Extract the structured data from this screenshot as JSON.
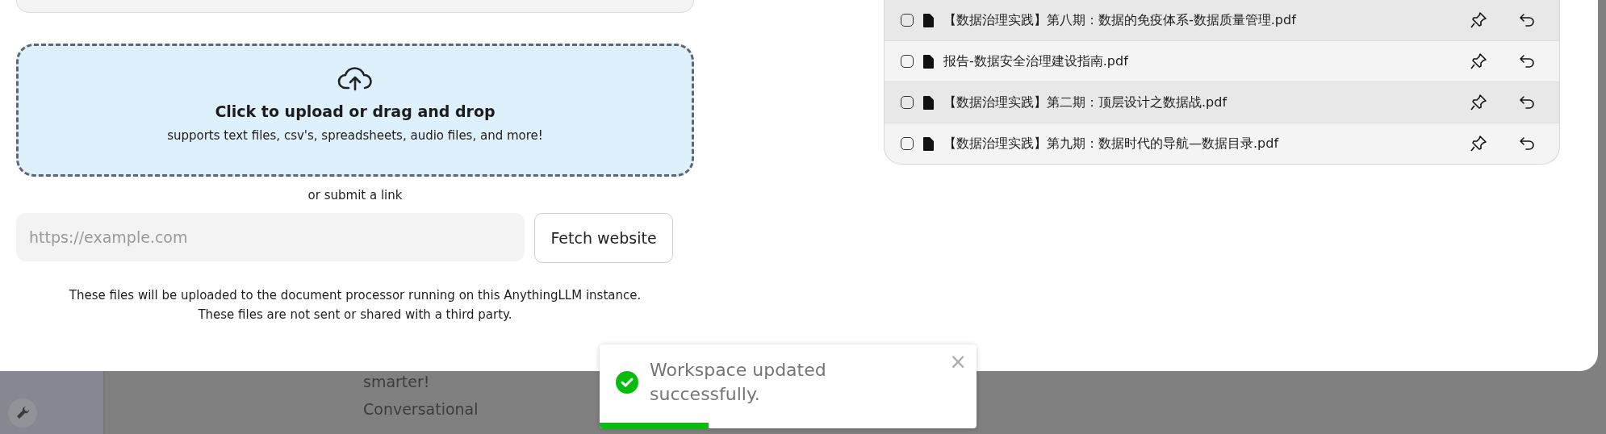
{
  "background": {
    "lines": [
      {
        "text": "smarter!"
      },
      {
        "text": "Conversational"
      }
    ]
  },
  "upload_panel": {
    "title": "Click to upload or drag and drop",
    "subtitle": "supports text files, csv's, spreadsheets, audio files, and more!",
    "link_prompt": "or submit a link",
    "link_field": {
      "placeholder": "https://example.com"
    },
    "fetch_button": "Fetch website",
    "notice": [
      "These files will be uploaded to the document processor running on this AnythingLLM instance.",
      "These files are not sent or shared with a third party."
    ]
  },
  "files": [
    {
      "name": "【数据治理实践】第八期：数据的免疫体系-数据质量管理.pdf",
      "checked": false
    },
    {
      "name": "报告-数据安全治理建设指南.pdf",
      "checked": false
    },
    {
      "name": "【数据治理实践】第二期：顶层设计之数据战.pdf",
      "checked": false
    },
    {
      "name": "【数据治理实践】第九期：数据时代的导航—数据目录.pdf",
      "checked": false
    }
  ],
  "toast": {
    "message": "Workspace updated successfully.",
    "close": "×",
    "level": 0.29
  }
}
